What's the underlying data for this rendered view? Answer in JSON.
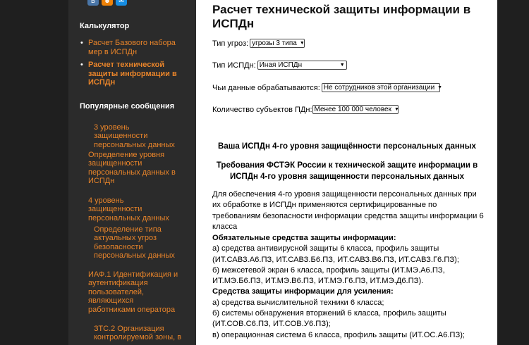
{
  "sidebar": {
    "calculator_heading": "Калькулятор",
    "calculator_items": [
      {
        "label": "Расчет Базового набора мер в ИСПДн",
        "current": false
      },
      {
        "label": "Расчет технической защиты информации в ИСПДн",
        "current": true
      }
    ],
    "popular_heading": "Популярные сообщения",
    "popular_items": [
      "3 уровень защищенности персональных данных",
      "Определение уровня защищенности персональных данных в ИСПДн",
      "4 уровень защищенности персональных данных",
      "Определение типа актуальных угроз безопасности персональных данных",
      "ИАФ.1 Идентификация и аутентификация пользователей, являющихся работниками оператора",
      "ЗТС.2 Организация контролируемой зоны, в"
    ]
  },
  "main": {
    "title": "Расчет технической защиты информации в ИСПДн",
    "form": {
      "threat_label": "Тип угроз:",
      "threat_value": "угрозы 3 типа",
      "ispdn_label": "Тип ИСПДн:",
      "ispdn_value": "Иная ИСПДн",
      "whose_label": "Чьи данные обрабатываются:",
      "whose_value": "Не сотрудников этой организации",
      "count_label": "Количество субъектов ПДн:",
      "count_value": "Менее 100 000 человек"
    },
    "result_level": "Ваша ИСПДн 4-го уровня защищённости персональных данных",
    "requirements_heading": "Требования ФСТЭК России к технической защите информации в ИСПДн 4-го уровня защищенности персональных данных",
    "intro": "Для обеспечения 4-го уровня защищенности персональных данных при их обработке в ИСПДн применяются сертифицированные по требованиям безопасности информации средства защиты информации 6 класса",
    "mandatory_heading": "Обязательные средства защиты информации:",
    "mandatory_a": "а) средства антивирусной защиты 6 класса, профиль защиты (ИТ.САВЗ.А6.ПЗ, ИТ.САВЗ.Б6.ПЗ, ИТ.САВЗ.В6.ПЗ, ИТ.САВЗ.Г6.ПЗ);",
    "mandatory_b": "б) межсетевой экран 6 класса, профиль защиты (ИТ.МЭ.А6.ПЗ, ИТ.МЭ.Б6.ПЗ, ИТ.МЭ.В6.ПЗ, ИТ.МЭ.Г6.ПЗ, ИТ.МЭ.Д6.ПЗ).",
    "strengthening_heading": "Средства защиты информации для усиления:",
    "strengthening_a": "а) средства вычислительной техники 6 класса;",
    "strengthening_b": "б) системы обнаружения вторжений 6 класса, профиль защиты (ИТ.СОВ.С6.ПЗ, ИТ.СОВ.У6.ПЗ);",
    "strengthening_c": "в) операционная система 6 класса, профиль защиты (ИТ.ОС.А6.ПЗ);"
  },
  "icons": {
    "social": [
      "vk-icon",
      "odnoklassniki-icon",
      "mail-icon"
    ]
  },
  "colors": {
    "link": "#e8842a",
    "sidebar_bg": "#2b2b2b",
    "gutter_bg": "#1f1f1f"
  }
}
